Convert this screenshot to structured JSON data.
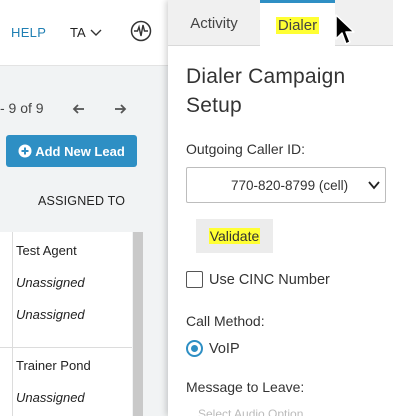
{
  "header": {
    "help_label": "HELP",
    "user_initials": "TA",
    "activity_icon": "pulse-icon"
  },
  "list": {
    "pager_text": "- 9 of 9",
    "add_lead_label": "Add New Lead",
    "assigned_to_header": "ASSIGNED TO",
    "rows": [
      {
        "assigned": "Test Agent"
      },
      {
        "assigned": "Unassigned"
      },
      {
        "assigned": "Unassigned"
      },
      {
        "assigned": "Trainer Pond"
      },
      {
        "assigned": "Unassigned"
      }
    ]
  },
  "panel": {
    "tabs": [
      {
        "label": "Activity"
      },
      {
        "label": "Dialer"
      }
    ],
    "active_tab": "Dialer",
    "title": "Dialer Campaign Setup",
    "caller_id_label": "Outgoing Caller ID:",
    "caller_id_value": "770-820-8799 (cell)",
    "validate_label": "Validate",
    "use_cinc_label": "Use CINC Number",
    "use_cinc_checked": false,
    "call_method_label": "Call Method:",
    "call_method_value": "VoIP",
    "message_label": "Message to Leave:",
    "faded_text": "Select Audio Option"
  },
  "colors": {
    "accent": "#2e8fc4",
    "highlight": "#ffff33"
  }
}
